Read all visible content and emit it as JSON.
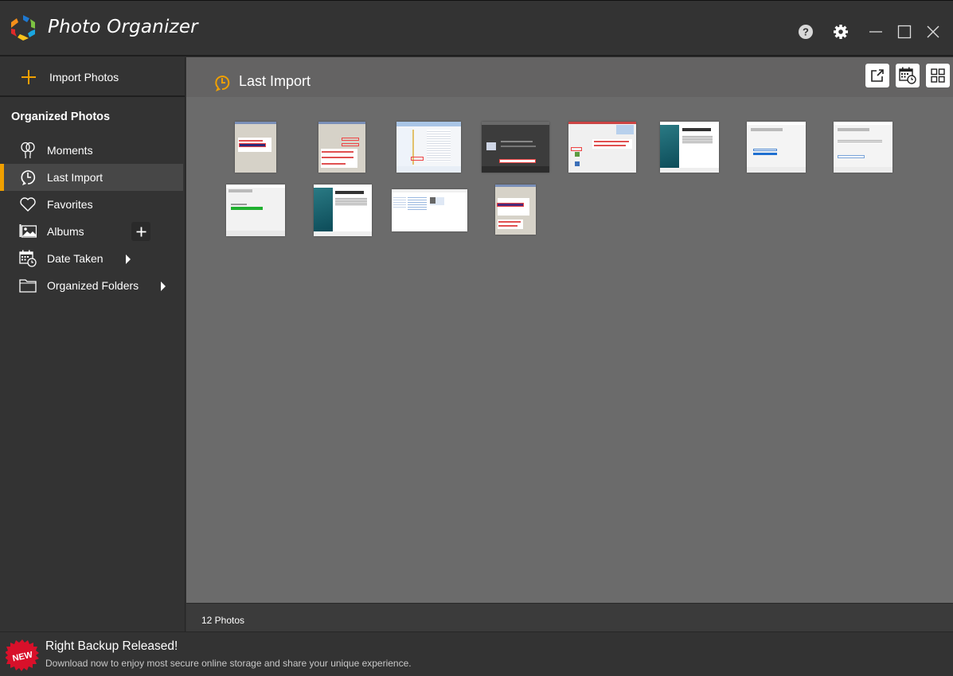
{
  "window": {
    "title": "Photo Organizer",
    "controls": {
      "help": "help-icon",
      "settings": "gear-icon",
      "minimize": "minimize-icon",
      "maximize": "maximize-icon",
      "close": "close-icon"
    }
  },
  "sidebar": {
    "import_label": "Import Photos",
    "section_title": "Organized Photos",
    "items": [
      {
        "label": "Moments",
        "icon": "balloons-icon",
        "active": false
      },
      {
        "label": "Last Import",
        "icon": "clock-import-icon",
        "active": true
      },
      {
        "label": "Favorites",
        "icon": "heart-icon",
        "active": false
      },
      {
        "label": "Albums",
        "icon": "image-icon",
        "active": false,
        "has_add": true
      },
      {
        "label": "Date Taken",
        "icon": "calendar-clock-icon",
        "active": false,
        "has_arrow": true
      },
      {
        "label": "Organized Folders",
        "icon": "folder-icon",
        "active": false,
        "has_arrow": true
      }
    ]
  },
  "content": {
    "title": "Last Import",
    "title_icon": "clock-import-icon",
    "view_buttons": [
      "open-external-icon",
      "calendar-view-icon",
      "grid-view-icon"
    ],
    "photos": [
      {
        "name": "screenshot-dialog-properties-1",
        "style": "classic-dialog"
      },
      {
        "name": "screenshot-dialog-ip-settings",
        "style": "classic-dialog-annotated"
      },
      {
        "name": "screenshot-file-explorer",
        "style": "explorer"
      },
      {
        "name": "screenshot-dark-installer",
        "style": "dark"
      },
      {
        "name": "screenshot-setup-welcome",
        "style": "setup"
      },
      {
        "name": "screenshot-wizard-welcome",
        "style": "wizard-teal"
      },
      {
        "name": "screenshot-wizard-select",
        "style": "wizard-white"
      },
      {
        "name": "screenshot-wizard-input",
        "style": "wizard-white"
      },
      {
        "name": "screenshot-progress",
        "style": "progress"
      },
      {
        "name": "screenshot-wizard-complete",
        "style": "wizard-teal"
      },
      {
        "name": "screenshot-control-panel",
        "style": "control-panel"
      },
      {
        "name": "screenshot-dialog-properties-2",
        "style": "classic-dialog"
      }
    ]
  },
  "status": {
    "count_label": "12 Photos"
  },
  "footer": {
    "badge": "NEW",
    "title": "Right Backup Released!",
    "text": "Download now to enjoy most secure online storage and share your unique experience."
  },
  "colors": {
    "accent": "#f0a000",
    "titlebar_bg": "#333333",
    "content_bg": "#6b6b6b",
    "header_bg": "#646363",
    "badge_red": "#d8102a"
  }
}
